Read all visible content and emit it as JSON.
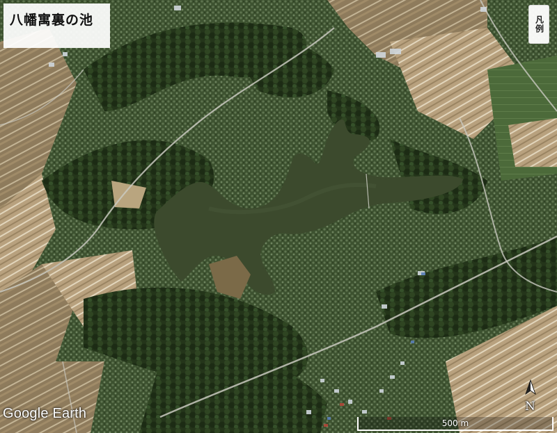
{
  "map": {
    "title": "八幡寓裏の池",
    "legend_button": "凡例",
    "attribution": "Google Earth",
    "scale_label": "500 m",
    "north_label": "N",
    "colors": {
      "water": "#3b4a2c",
      "forest": "#2c3d1f",
      "field": "#8a7a5a",
      "road": "#c9c9c0"
    }
  }
}
